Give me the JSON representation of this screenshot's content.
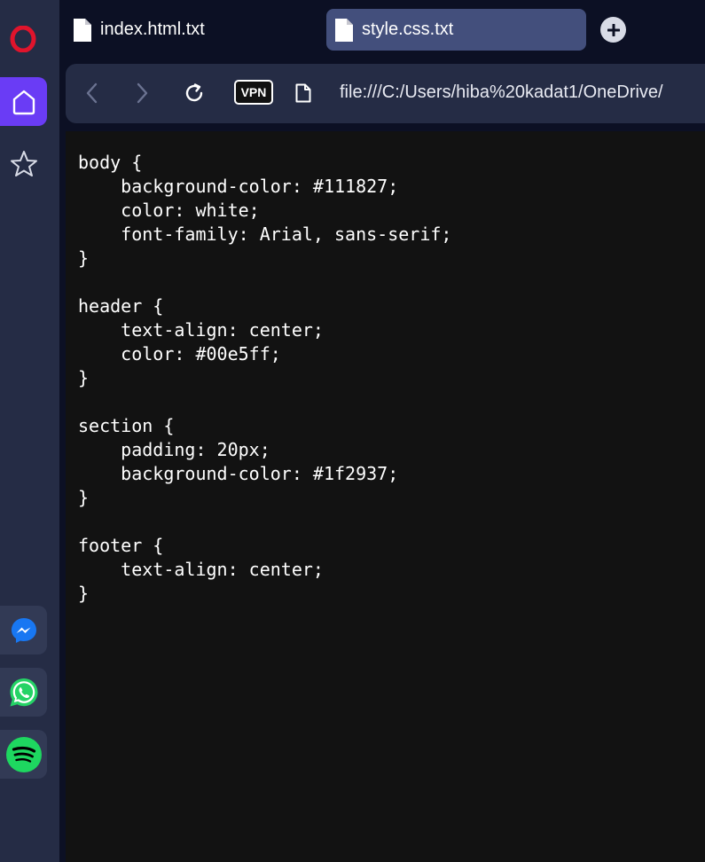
{
  "sidebar": {
    "logo": "opera-logo",
    "items": [
      {
        "name": "home",
        "icon": "home-icon",
        "active": true
      },
      {
        "name": "pinboards",
        "icon": "star-icon",
        "active": false
      },
      {
        "name": "messenger",
        "icon": "messenger-icon",
        "color": "#1877f2"
      },
      {
        "name": "whatsapp",
        "icon": "whatsapp-icon",
        "color": "#25d366"
      },
      {
        "name": "spotify",
        "icon": "spotify-icon",
        "color": "#1ed760"
      }
    ]
  },
  "tabs": [
    {
      "label": "index.html.txt",
      "icon": "file-icon",
      "active": false
    },
    {
      "label": "style.css.txt",
      "icon": "file-icon",
      "active": true
    }
  ],
  "new_tab_icon": "plus-icon",
  "addressbar": {
    "vpn_label": "VPN",
    "url": "file:///C:/Users/hiba%20kadat1/OneDrive/"
  },
  "document": {
    "text": "body {\n    background-color: #111827;\n    color: white;\n    font-family: Arial, sans-serif;\n}\n\nheader {\n    text-align: center;\n    color: #00e5ff;\n}\n\nsection {\n    padding: 20px;\n    background-color: #1f2937;\n}\n\nfooter {\n    text-align: center;\n}"
  },
  "colors": {
    "accent": "#6a3cf5",
    "active_tab": "#434f7c",
    "chrome": "#252c45",
    "background": "#0c1024",
    "content": "#121212"
  }
}
